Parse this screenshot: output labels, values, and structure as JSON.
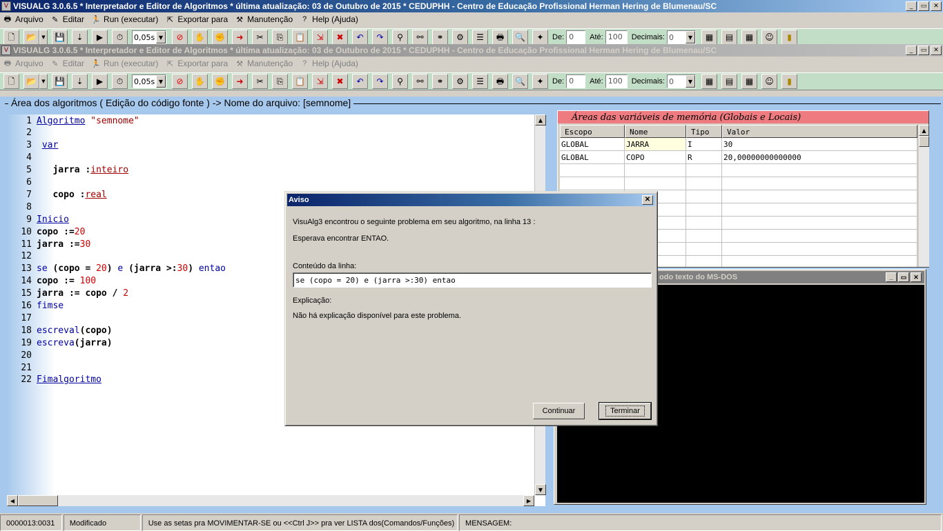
{
  "window": {
    "title": "VISUALG 3.0.6.5 * Interpretador e Editor de Algoritmos * última atualização: 03 de Outubro de 2015 * CEDUPHH - Centro de Educação Profissional Herman Hering de Blumenau/SC",
    "btn_min": "_",
    "btn_restore": "▭",
    "btn_close": "✕"
  },
  "menu": [
    {
      "label": "Arquivo",
      "icon": "printer-icon",
      "glyph": "🖶"
    },
    {
      "label": "Editar",
      "icon": "edit-icon",
      "glyph": "✎"
    },
    {
      "label": "Run (executar)",
      "icon": "run-icon",
      "glyph": "🏃"
    },
    {
      "label": "Exportar para",
      "icon": "export-icon",
      "glyph": "⇱"
    },
    {
      "label": "Manutenção",
      "icon": "tools-icon",
      "glyph": "⚒"
    },
    {
      "label": "Help (Ajuda)",
      "icon": "help-icon",
      "glyph": "?"
    }
  ],
  "toolbar": {
    "speed": "0,05s",
    "de_label": "De:",
    "de_value": "0",
    "ate_label": "Até:",
    "ate_value": "100",
    "decimais_label": "Decimais:",
    "decimais_value": "0"
  },
  "editor": {
    "legend": "Área dos algoritmos ( Edição do código fonte ) -> Nome do arquivo: [semnome]",
    "lines": [
      {
        "n": "1",
        "segs": [
          {
            "c": "kwu",
            "t": "Algoritmo"
          },
          {
            "c": "",
            "t": " "
          },
          {
            "c": "str",
            "t": "\"semnome\""
          }
        ]
      },
      {
        "n": "2",
        "segs": []
      },
      {
        "n": "3",
        "segs": [
          {
            "c": "",
            "t": " "
          },
          {
            "c": "kwu",
            "t": "var"
          }
        ]
      },
      {
        "n": "4",
        "segs": []
      },
      {
        "n": "5",
        "segs": [
          {
            "c": "idb",
            "t": "   jarra :"
          },
          {
            "c": "typ",
            "t": "inteiro"
          }
        ]
      },
      {
        "n": "6",
        "segs": []
      },
      {
        "n": "7",
        "segs": [
          {
            "c": "idb",
            "t": "   copo :"
          },
          {
            "c": "typ",
            "t": "real"
          }
        ]
      },
      {
        "n": "8",
        "segs": []
      },
      {
        "n": "9",
        "segs": [
          {
            "c": "kwu",
            "t": "Inicio"
          }
        ]
      },
      {
        "n": "10",
        "segs": [
          {
            "c": "idb",
            "t": "copo :="
          },
          {
            "c": "num",
            "t": "20"
          }
        ]
      },
      {
        "n": "11",
        "segs": [
          {
            "c": "idb",
            "t": "jarra :="
          },
          {
            "c": "num",
            "t": "30"
          }
        ]
      },
      {
        "n": "12",
        "segs": []
      },
      {
        "n": "13",
        "segs": [
          {
            "c": "kw",
            "t": "se"
          },
          {
            "c": "idb",
            "t": " (copo = "
          },
          {
            "c": "num",
            "t": "20"
          },
          {
            "c": "idb",
            "t": ") "
          },
          {
            "c": "kw",
            "t": "e"
          },
          {
            "c": "idb",
            "t": " (jarra >:"
          },
          {
            "c": "num",
            "t": "30"
          },
          {
            "c": "idb",
            "t": ") "
          },
          {
            "c": "kw",
            "t": "entao"
          }
        ]
      },
      {
        "n": "14",
        "segs": [
          {
            "c": "idb",
            "t": "copo := "
          },
          {
            "c": "num",
            "t": "100"
          }
        ]
      },
      {
        "n": "15",
        "segs": [
          {
            "c": "idb",
            "t": "jarra := copo / "
          },
          {
            "c": "num",
            "t": "2"
          }
        ]
      },
      {
        "n": "16",
        "segs": [
          {
            "c": "kw",
            "t": "fimse"
          }
        ]
      },
      {
        "n": "17",
        "segs": []
      },
      {
        "n": "18",
        "segs": [
          {
            "c": "kw",
            "t": "escreval"
          },
          {
            "c": "idb",
            "t": "(copo)"
          }
        ]
      },
      {
        "n": "19",
        "segs": [
          {
            "c": "kw",
            "t": "escreva"
          },
          {
            "c": "idb",
            "t": "(jarra)"
          }
        ]
      },
      {
        "n": "20",
        "segs": []
      },
      {
        "n": "21",
        "segs": []
      },
      {
        "n": "22",
        "segs": [
          {
            "c": "kwu",
            "t": "Fimalgoritmo"
          }
        ]
      }
    ]
  },
  "variables": {
    "title": "Áreas das variáveis de memória (Globais e Locais)",
    "headers": [
      "Escopo",
      "Nome",
      "Tipo",
      "Valor"
    ],
    "rows": [
      [
        "GLOBAL",
        "JARRA",
        "I",
        "30"
      ],
      [
        "GLOBAL",
        "COPO",
        "R",
        "20,00000000000000"
      ]
    ]
  },
  "dos": {
    "title": "odo texto do MS-DOS"
  },
  "dialog": {
    "title": "Aviso",
    "message": "VisuAlg3 encontrou o seguinte problema em seu algoritmo, na linha 13 :",
    "expected": "Esperava encontrar ENTAO.",
    "content_label": "Conteúdo da linha:",
    "content_value": "se (copo = 20) e (jarra >:30) entao",
    "explanation_label": "Explicação:",
    "explanation_text": "Não há explicação disponível para este problema.",
    "btn_continue": "Continuar",
    "btn_terminate": "Terminar"
  },
  "status": {
    "position": "0000013:0031",
    "state": "Modificado",
    "hint": "Use as setas pra MOVIMENTAR-SE ou <<Ctrl J>> pra ver LISTA dos(Comandos/Funções)",
    "message": "MENSAGEM:"
  }
}
